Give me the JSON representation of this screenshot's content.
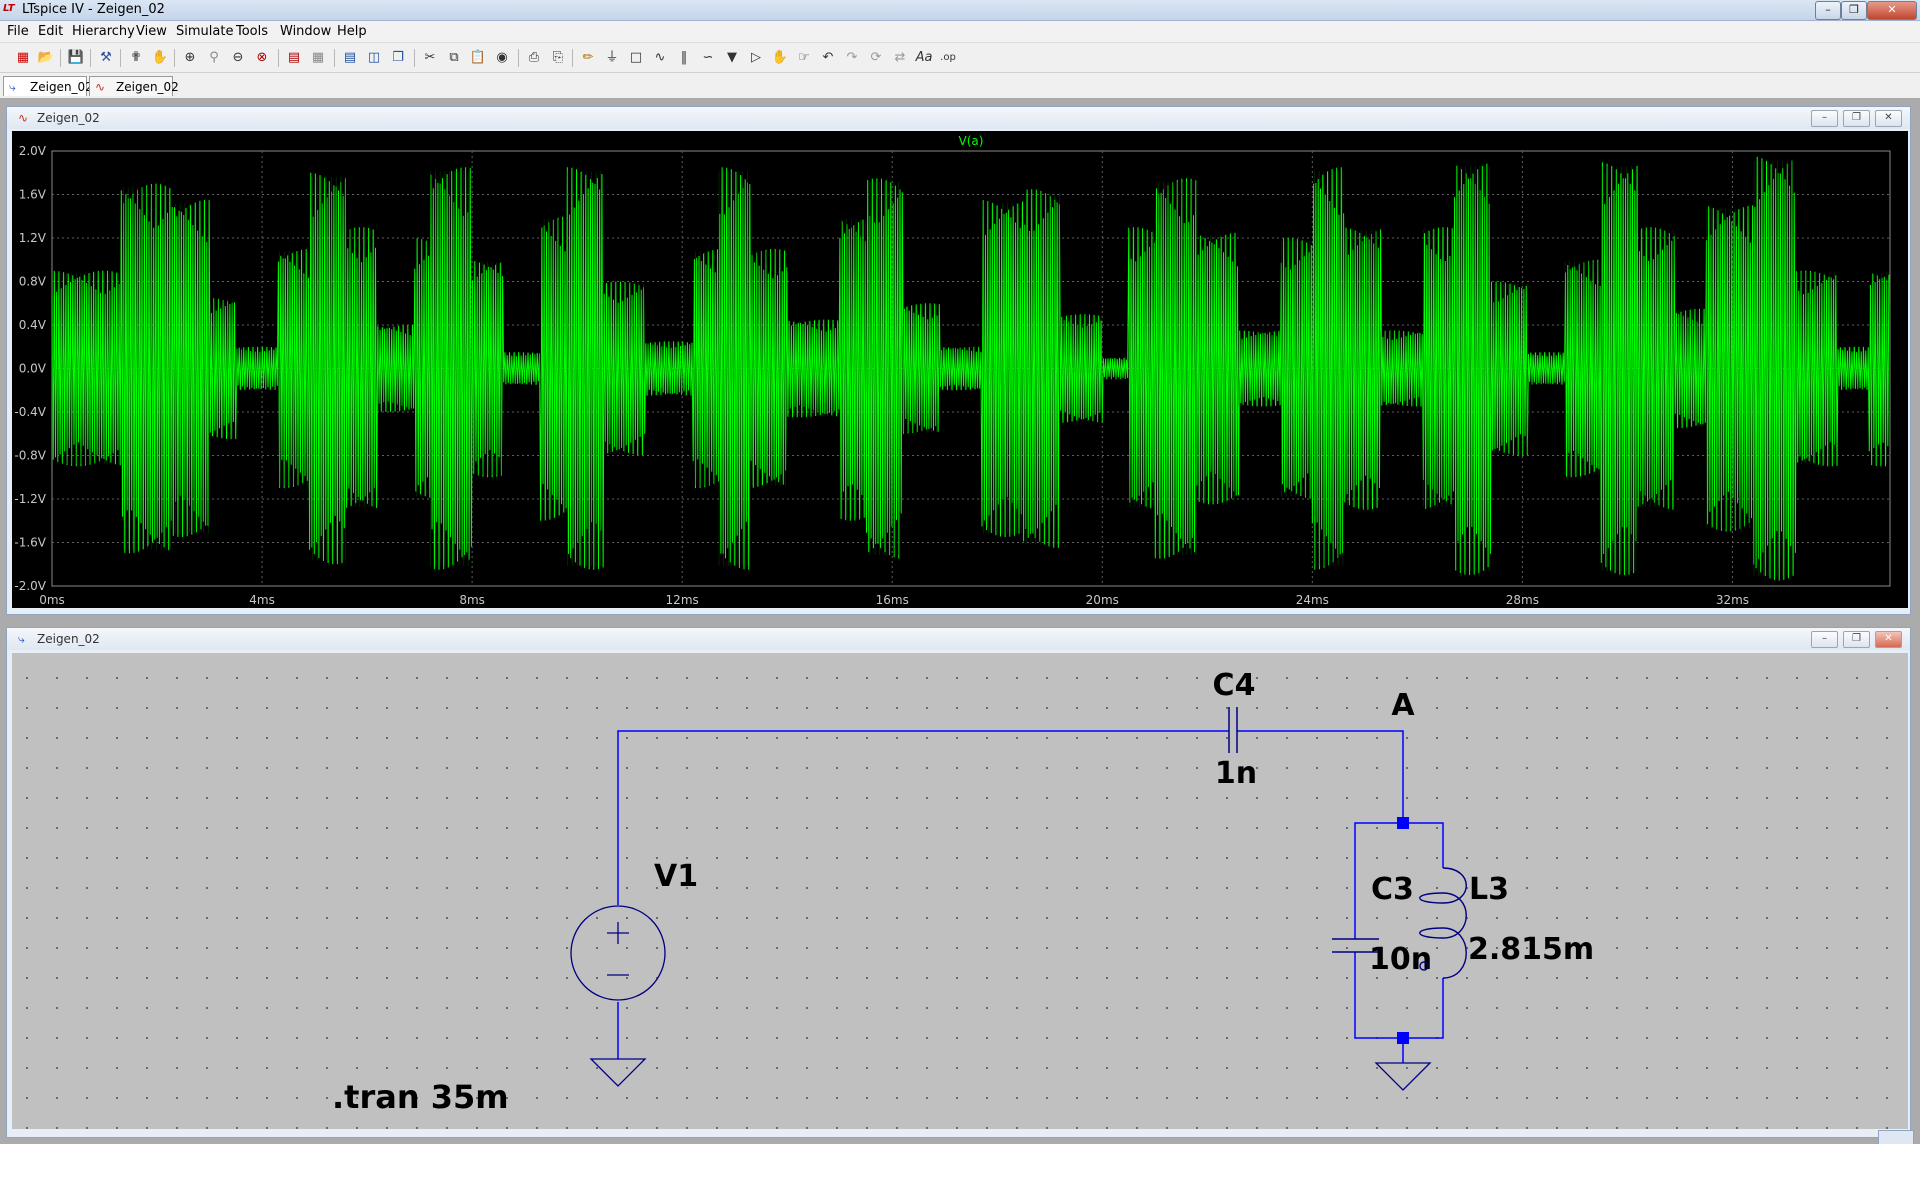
{
  "window": {
    "title": "LTspice IV - Zeigen_02",
    "logo_text": "LT"
  },
  "menu": {
    "items": [
      {
        "label": "File",
        "name": "menu-file"
      },
      {
        "label": "Edit",
        "name": "menu-edit"
      },
      {
        "label": "Hierarchy",
        "name": "menu-hierarchy"
      },
      {
        "label": "View",
        "name": "menu-view"
      },
      {
        "label": "Simulate",
        "name": "menu-simulate"
      },
      {
        "label": "Tools",
        "name": "menu-tools"
      },
      {
        "label": "Window",
        "name": "menu-window"
      },
      {
        "label": "Help",
        "name": "menu-help"
      }
    ]
  },
  "doc_tabs": [
    {
      "label": "Zeigen_02",
      "icon": "schematic-icon",
      "active": true
    },
    {
      "label": "Zeigen_02",
      "icon": "waveform-icon",
      "active": false
    }
  ],
  "plot_window": {
    "title": "Zeigen_02",
    "icon": "waveform-icon",
    "trace_label": "V(a)",
    "colors": {
      "background": "#000000",
      "trace": "#00ff00",
      "grid": "#606060",
      "axis_text": "#c8c8c8"
    }
  },
  "chart_data": {
    "type": "line",
    "title": "",
    "series": [
      {
        "name": "V(a)",
        "color": "#00ff00"
      }
    ],
    "xlabel": "",
    "ylabel": "",
    "x_ticks": [
      "0ms",
      "4ms",
      "8ms",
      "12ms",
      "16ms",
      "20ms",
      "24ms",
      "28ms",
      "32ms"
    ],
    "y_ticks": [
      "2.0V",
      "1.6V",
      "1.2V",
      "0.8V",
      "0.4V",
      "0.0V",
      "-0.4V",
      "-0.8V",
      "-1.2V",
      "-1.6V",
      "-2.0V"
    ],
    "xlim_ms": [
      0,
      35
    ],
    "ylim_V": [
      -2.0,
      2.0
    ],
    "grid": true,
    "envelope_peaks": [
      {
        "t_ms": 0.7,
        "amp_V": 0.9
      },
      {
        "t_ms": 1.3,
        "amp_V": 1.7
      },
      {
        "t_ms": 2.3,
        "amp_V": 1.55
      },
      {
        "t_ms": 3.0,
        "amp_V": 0.65
      },
      {
        "t_ms": 3.5,
        "amp_V": 0.2
      },
      {
        "t_ms": 4.3,
        "amp_V": 1.1
      },
      {
        "t_ms": 4.9,
        "amp_V": 1.8
      },
      {
        "t_ms": 5.6,
        "amp_V": 1.3
      },
      {
        "t_ms": 6.2,
        "amp_V": 0.4
      },
      {
        "t_ms": 6.9,
        "amp_V": 1.2
      },
      {
        "t_ms": 7.2,
        "amp_V": 1.85
      },
      {
        "t_ms": 8.0,
        "amp_V": 1.0
      },
      {
        "t_ms": 8.6,
        "amp_V": 0.15
      },
      {
        "t_ms": 9.3,
        "amp_V": 1.4
      },
      {
        "t_ms": 9.8,
        "amp_V": 1.85
      },
      {
        "t_ms": 10.5,
        "amp_V": 0.8
      },
      {
        "t_ms": 11.3,
        "amp_V": 0.25
      },
      {
        "t_ms": 12.2,
        "amp_V": 1.1
      },
      {
        "t_ms": 12.7,
        "amp_V": 1.85
      },
      {
        "t_ms": 13.3,
        "amp_V": 1.1
      },
      {
        "t_ms": 14.0,
        "amp_V": 0.45
      },
      {
        "t_ms": 15.0,
        "amp_V": 1.4
      },
      {
        "t_ms": 15.5,
        "amp_V": 1.75
      },
      {
        "t_ms": 16.2,
        "amp_V": 0.6
      },
      {
        "t_ms": 16.9,
        "amp_V": 0.2
      },
      {
        "t_ms": 17.7,
        "amp_V": 1.55
      },
      {
        "t_ms": 18.5,
        "amp_V": 1.65
      },
      {
        "t_ms": 19.2,
        "amp_V": 0.5
      },
      {
        "t_ms": 20.0,
        "amp_V": 0.1
      },
      {
        "t_ms": 20.5,
        "amp_V": 1.3
      },
      {
        "t_ms": 21.0,
        "amp_V": 1.75
      },
      {
        "t_ms": 21.8,
        "amp_V": 1.25
      },
      {
        "t_ms": 22.6,
        "amp_V": 0.35
      },
      {
        "t_ms": 23.4,
        "amp_V": 1.2
      },
      {
        "t_ms": 24.0,
        "amp_V": 1.85
      },
      {
        "t_ms": 24.6,
        "amp_V": 1.3
      },
      {
        "t_ms": 25.3,
        "amp_V": 0.35
      },
      {
        "t_ms": 26.1,
        "amp_V": 1.3
      },
      {
        "t_ms": 26.7,
        "amp_V": 1.9
      },
      {
        "t_ms": 27.4,
        "amp_V": 0.8
      },
      {
        "t_ms": 28.1,
        "amp_V": 0.15
      },
      {
        "t_ms": 28.8,
        "amp_V": 1.0
      },
      {
        "t_ms": 29.5,
        "amp_V": 1.9
      },
      {
        "t_ms": 30.2,
        "amp_V": 1.3
      },
      {
        "t_ms": 30.9,
        "amp_V": 0.55
      },
      {
        "t_ms": 31.5,
        "amp_V": 1.5
      },
      {
        "t_ms": 32.4,
        "amp_V": 1.95
      },
      {
        "t_ms": 33.2,
        "amp_V": 0.9
      },
      {
        "t_ms": 34.0,
        "amp_V": 0.2
      },
      {
        "t_ms": 34.6,
        "amp_V": 0.9
      },
      {
        "t_ms": 35.0,
        "amp_V": 0.9
      }
    ]
  },
  "schematic_window": {
    "title": "Zeigen_02",
    "icon": "schematic-icon",
    "colors": {
      "background": "#c0c0c0",
      "wire": "#0000ff",
      "component": "#000080",
      "junction": "#0000ff"
    },
    "components": {
      "v1": {
        "ref": "V1"
      },
      "c4": {
        "ref": "C4",
        "value": "1n"
      },
      "c3": {
        "ref": "C3",
        "value": "10n"
      },
      "l3": {
        "ref": "L3",
        "value": "2.815m"
      }
    },
    "net_label": "A",
    "directive": ".tran 35m"
  }
}
